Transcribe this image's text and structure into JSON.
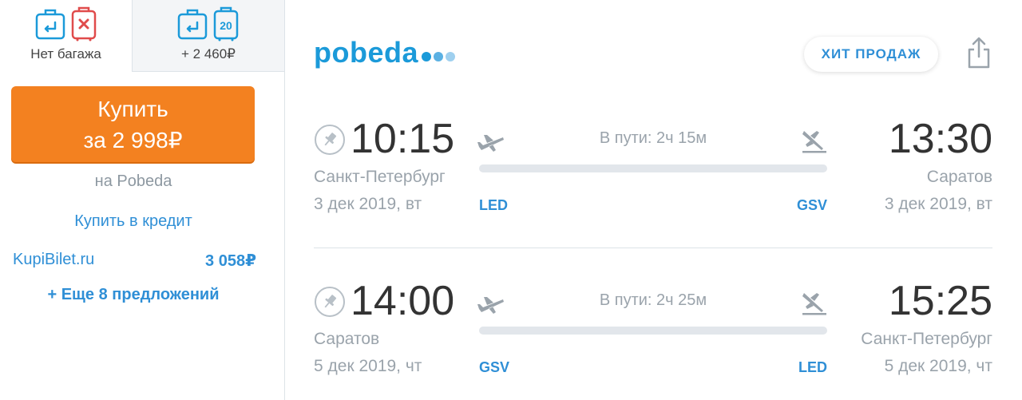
{
  "baggage": {
    "no_bag": {
      "label": "Нет багажа"
    },
    "with_bag": {
      "label": "+ 2 460₽",
      "weight": "20"
    }
  },
  "offer": {
    "buy_label": "Купить",
    "buy_price": "за 2 998₽",
    "seller": "на Pobeda",
    "credit_link": "Купить в кредит",
    "alternative": {
      "name": "KupiBilet.ru",
      "price": "3 058₽"
    },
    "more_offers": "+ Еще 8 предложений"
  },
  "airline": {
    "name": "pobeda",
    "badge": "ХИТ ПРОДАЖ"
  },
  "flights": [
    {
      "dep_time": "10:15",
      "dep_city": "Санкт-Петербург",
      "dep_date": "3 дек 2019, вт",
      "dep_code": "LED",
      "duration": "В пути: 2ч 15м",
      "arr_time": "13:30",
      "arr_city": "Саратов",
      "arr_date": "3 дек 2019, вт",
      "arr_code": "GSV"
    },
    {
      "dep_time": "14:00",
      "dep_city": "Саратов",
      "dep_date": "5 дек 2019, чт",
      "dep_code": "GSV",
      "duration": "В пути: 2ч 25м",
      "arr_time": "15:25",
      "arr_city": "Санкт-Петербург",
      "arr_date": "5 дек 2019, чт",
      "arr_code": "LED"
    }
  ],
  "colors": {
    "accent": "#2f8fd6",
    "buy_button": "#f38120",
    "logo_dots": [
      "#1b9ad9",
      "#5bb1e3",
      "#9fd0ef"
    ]
  },
  "icons": {
    "hand_luggage": "hand-luggage-icon",
    "no_suitcase": "no-suitcase-icon",
    "suitcase": "suitcase-icon",
    "pin": "pin-icon",
    "takeoff": "takeoff-icon",
    "landing": "landing-icon",
    "share": "share-icon"
  }
}
